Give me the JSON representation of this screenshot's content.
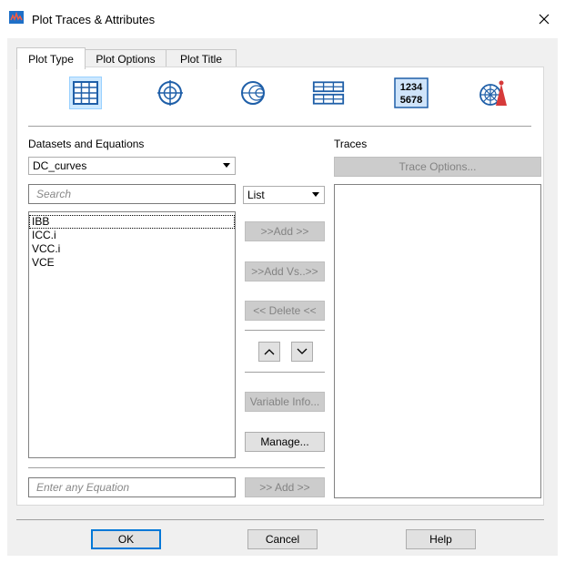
{
  "window": {
    "title": "Plot Traces & Attributes",
    "close_glyph": "✕"
  },
  "tabs": [
    {
      "label": "Plot Type"
    },
    {
      "label": "Plot Options"
    },
    {
      "label": "Plot Title"
    }
  ],
  "plot_types": [
    {
      "icon": "rectangular-grid-icon",
      "selected": true
    },
    {
      "icon": "polar-plot-icon"
    },
    {
      "icon": "smith-chart-icon"
    },
    {
      "icon": "stacked-grid-icon"
    },
    {
      "icon": "tabular-data-icon",
      "text_top": "1234",
      "text_bottom": "5678"
    },
    {
      "icon": "antenna-plot-icon"
    }
  ],
  "datasets": {
    "label": "Datasets and Equations",
    "selected": "DC_curves",
    "search_placeholder": "Search",
    "view_mode": "List",
    "items": [
      "IBB",
      "ICC.i",
      "VCC.i",
      "VCE"
    ],
    "equation_placeholder": "Enter any Equation"
  },
  "middle": {
    "add": ">>Add >>",
    "add_vs": ">>Add Vs..>>",
    "delete": "<< Delete <<",
    "variable_info": "Variable Info...",
    "manage": "Manage...",
    "add_eq": ">> Add >>"
  },
  "traces": {
    "label": "Traces",
    "options": "Trace Options..."
  },
  "footer": {
    "ok": "OK",
    "cancel": "Cancel",
    "help": "Help"
  },
  "colors": {
    "accent": "#0078d7",
    "selection": "#cce8ff",
    "icon_blue": "#1f5fa8"
  }
}
